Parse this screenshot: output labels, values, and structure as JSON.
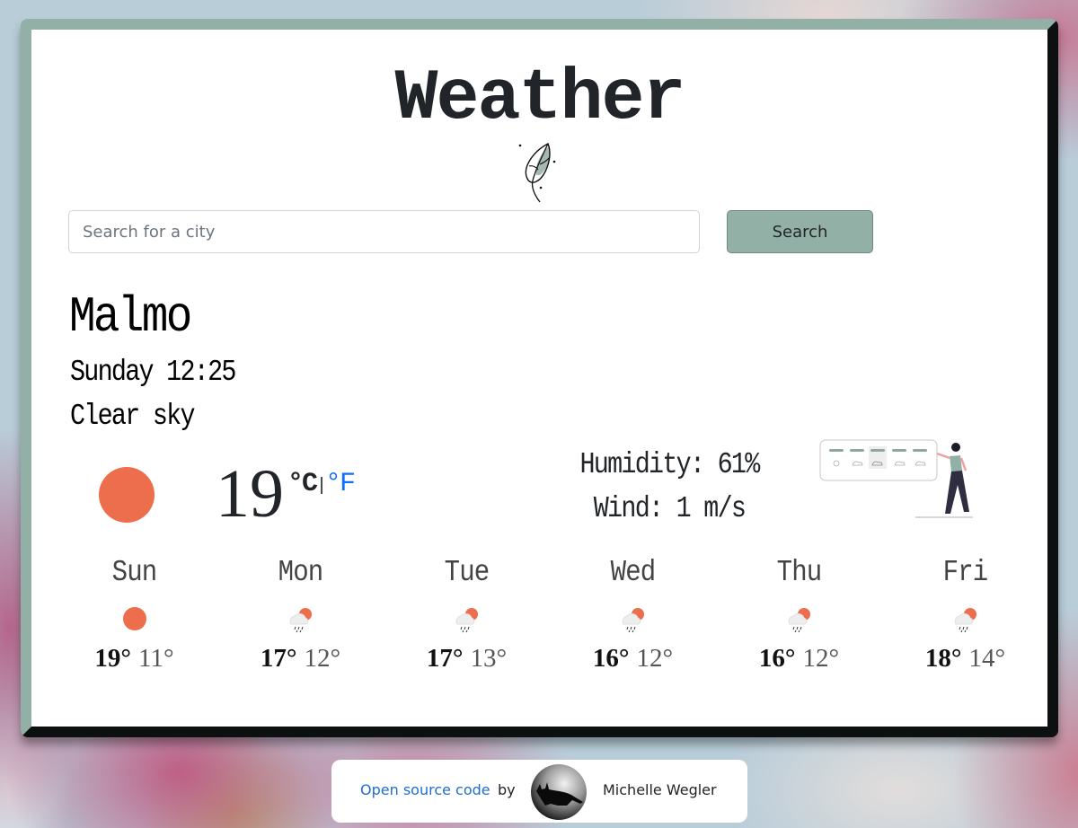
{
  "header": {
    "title": "Weather",
    "logo_icon": "leaf-icon"
  },
  "search": {
    "placeholder": "Search for a city",
    "value": "",
    "button_label": "Search"
  },
  "current": {
    "city": "Malmo",
    "datetime": "Sunday 12:25",
    "description": "Clear sky",
    "icon": "sun-icon",
    "temperature": "19",
    "unit_celsius": "°C",
    "unit_separator": "|",
    "unit_fahrenheit": "°F",
    "humidity": "Humidity: 61%",
    "wind": "Wind: 1 m/s",
    "illustration": "weather-forecast-illustration"
  },
  "forecast": [
    {
      "day": "Sun",
      "icon": "sun-icon",
      "max": "19°",
      "min": "11°"
    },
    {
      "day": "Mon",
      "icon": "rain-sun-icon",
      "max": "17°",
      "min": "12°"
    },
    {
      "day": "Tue",
      "icon": "rain-sun-icon",
      "max": "17°",
      "min": "13°"
    },
    {
      "day": "Wed",
      "icon": "rain-sun-icon",
      "max": "16°",
      "min": "12°"
    },
    {
      "day": "Thu",
      "icon": "rain-sun-icon",
      "max": "16°",
      "min": "12°"
    },
    {
      "day": "Fri",
      "icon": "rain-sun-icon",
      "max": "18°",
      "min": "14°"
    }
  ],
  "footer": {
    "link_label": "Open source code",
    "by_label": "by",
    "author": "Michelle Wegler"
  },
  "colors": {
    "accent": "#93b0a6",
    "accent_dark": "#4f6560",
    "sun": "#ec6e4c",
    "link": "#0d6efd"
  }
}
